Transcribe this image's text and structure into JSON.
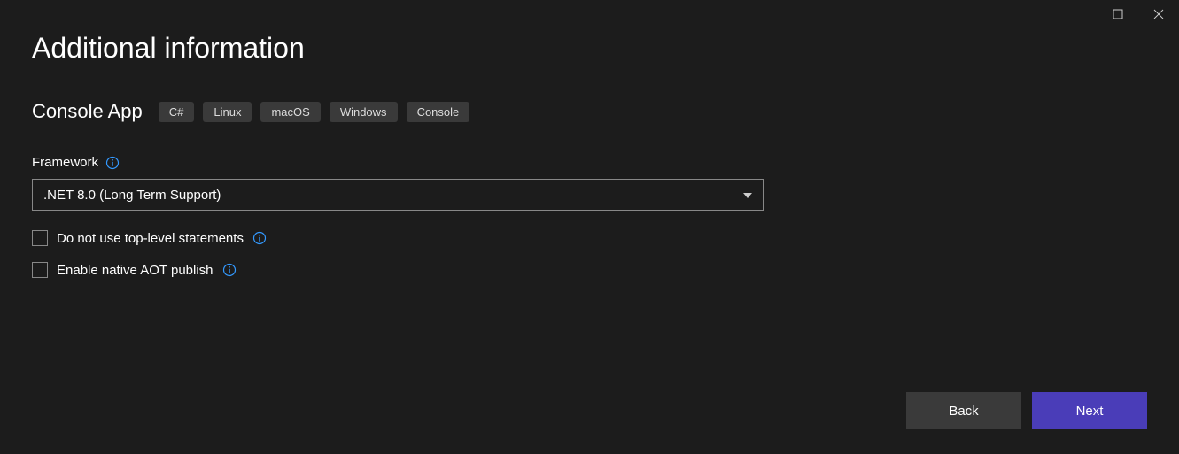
{
  "title": "Additional information",
  "subtitle": "Console App",
  "tags": [
    "C#",
    "Linux",
    "macOS",
    "Windows",
    "Console"
  ],
  "framework": {
    "label": "Framework",
    "selected": ".NET 8.0 (Long Term Support)"
  },
  "checkboxes": [
    {
      "label": "Do not use top-level statements"
    },
    {
      "label": "Enable native AOT publish"
    }
  ],
  "buttons": {
    "back": "Back",
    "next": "Next"
  }
}
